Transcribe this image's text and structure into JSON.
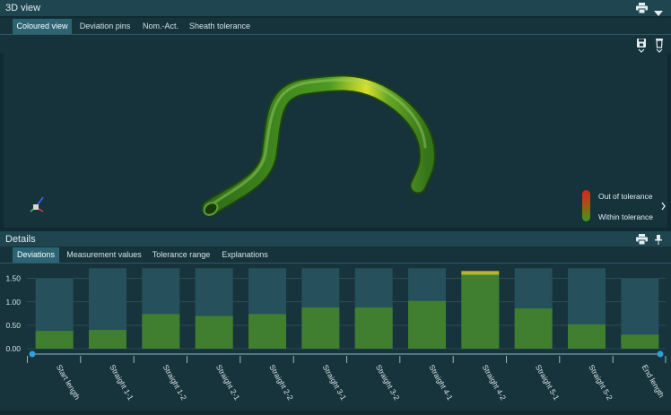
{
  "top_panel": {
    "title": "3D view",
    "tabs": [
      {
        "label": "Coloured view",
        "active": true
      },
      {
        "label": "Deviation pins",
        "active": false
      },
      {
        "label": "Nom.-Act.",
        "active": false
      },
      {
        "label": "Sheath tolerance",
        "active": false
      }
    ],
    "legend": {
      "out_label": "Out of tolerance",
      "within_label": "Within tolerance"
    },
    "colors": {
      "accent_tab": "#2c6474",
      "tube_green": "#3f8a1e",
      "tube_highlight": "#d8e02a"
    }
  },
  "details_panel": {
    "title": "Details",
    "tabs": [
      {
        "label": "Deviations",
        "active": true
      },
      {
        "label": "Measurement values",
        "active": false
      },
      {
        "label": "Tolerance range",
        "active": false
      },
      {
        "label": "Explanations",
        "active": false
      }
    ]
  },
  "chart_data": {
    "type": "bar",
    "categories": [
      "Start length",
      "Straight 1-1",
      "Straight 1-2",
      "Straight 2-1",
      "Straight 2-2",
      "Straight 3-1",
      "Straight 3-2",
      "Straight 4-1",
      "Straight 4-2",
      "Straight 5-1",
      "Straight 5-2",
      "End length"
    ],
    "series": [
      {
        "values": [
          0.38,
          0.4,
          0.74,
          0.7,
          0.74,
          0.88,
          0.88,
          1.02,
          1.58,
          0.86,
          0.52,
          0.3
        ]
      }
    ],
    "tolerance": [
      1.5,
      1.72,
      1.72,
      1.72,
      1.72,
      1.72,
      1.72,
      1.72,
      1.58,
      1.72,
      1.72,
      1.5
    ],
    "exceed": [
      0,
      0,
      0,
      0,
      0,
      0,
      0,
      0,
      0.08,
      0,
      0,
      0
    ],
    "yticks": [
      "0.00",
      "0.50",
      "1.00",
      "1.50"
    ],
    "ylim": [
      0,
      1.82
    ],
    "grid": true,
    "colors": {
      "within": "#3f7f2f",
      "band": "#26505c",
      "exceed": "#b8b530"
    }
  }
}
